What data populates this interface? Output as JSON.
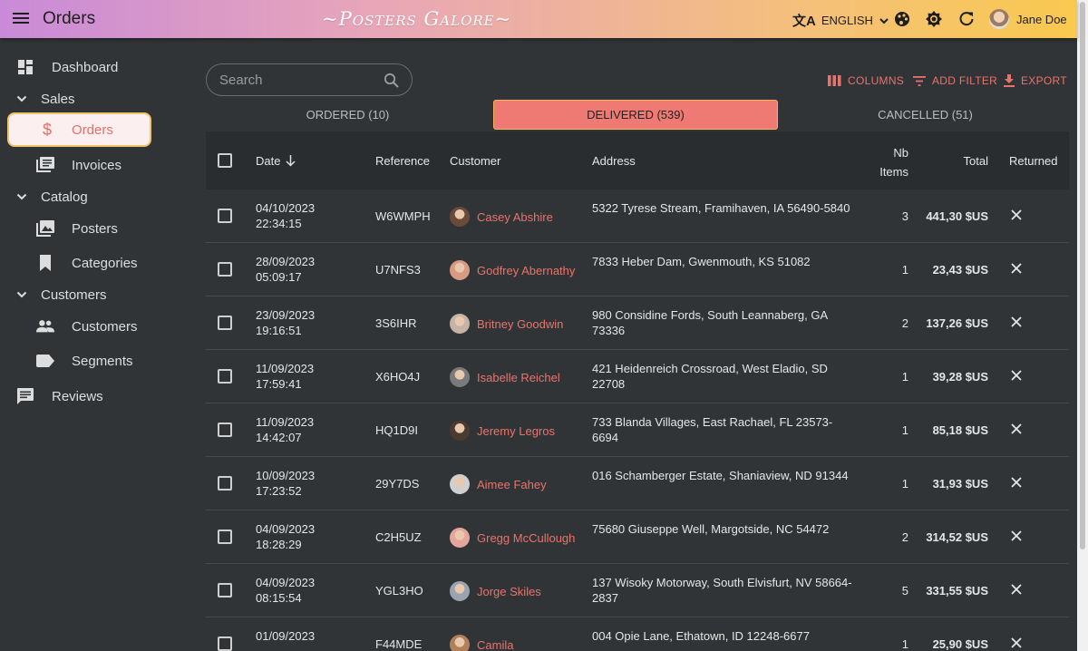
{
  "appbar": {
    "title": "Orders",
    "brand": "~Posters Galore~",
    "language": "ENGLISH",
    "user_name": "Jane Doe"
  },
  "sidebar": {
    "items": [
      {
        "label": "Dashboard",
        "icon": "dashboard-icon"
      },
      {
        "label": "Sales",
        "icon": "chevron-down-icon"
      },
      {
        "label": "Orders",
        "icon": "dollar-icon"
      },
      {
        "label": "Invoices",
        "icon": "invoices-icon"
      },
      {
        "label": "Catalog",
        "icon": "chevron-down-icon"
      },
      {
        "label": "Posters",
        "icon": "image-icon"
      },
      {
        "label": "Categories",
        "icon": "bookmark-icon"
      },
      {
        "label": "Customers",
        "icon": "chevron-down-icon"
      },
      {
        "label": "Customers",
        "icon": "people-icon"
      },
      {
        "label": "Segments",
        "icon": "label-icon"
      },
      {
        "label": "Reviews",
        "icon": "comment-icon"
      }
    ]
  },
  "search": {
    "placeholder": "Search"
  },
  "toolbar": {
    "columns": "COLUMNS",
    "add_filter": "ADD FILTER",
    "export": "EXPORT"
  },
  "tabs": [
    {
      "label": "ORDERED (10)"
    },
    {
      "label": "DELIVERED (539)"
    },
    {
      "label": "CANCELLED (51)"
    }
  ],
  "table": {
    "headers": {
      "date": "Date",
      "reference": "Reference",
      "customer": "Customer",
      "address": "Address",
      "nb_items_1": "Nb",
      "nb_items_2": "Items",
      "total": "Total",
      "returned": "Returned"
    },
    "rows": [
      {
        "date": "04/10/2023",
        "time": "22:34:15",
        "reference": "W6WMPH",
        "customer": "Casey Abshire",
        "address": "5322 Tyrese Stream, Framihaven, IA 56490-5840",
        "items": "3",
        "total": "441,30 $US"
      },
      {
        "date": "28/09/2023",
        "time": "05:09:17",
        "reference": "U7NFS3",
        "customer": "Godfrey Abernathy",
        "address": "7833 Heber Dam, Gwenmouth, KS 51082",
        "items": "1",
        "total": "23,43 $US"
      },
      {
        "date": "23/09/2023",
        "time": "19:16:51",
        "reference": "3S6IHR",
        "customer": "Britney Goodwin",
        "address": "980 Considine Fords, South Leannaberg, GA 73336",
        "items": "2",
        "total": "137,26 $US"
      },
      {
        "date": "11/09/2023",
        "time": "17:59:41",
        "reference": "X6HO4J",
        "customer": "Isabelle Reichel",
        "address": "421 Heidenreich Crossroad, West Eladio, SD 22708",
        "items": "1",
        "total": "39,28 $US"
      },
      {
        "date": "11/09/2023",
        "time": "14:42:07",
        "reference": "HQ1D9I",
        "customer": "Jeremy Legros",
        "address": "733 Blanda Villages, East Rachael, FL 23573-6694",
        "items": "1",
        "total": "85,18 $US"
      },
      {
        "date": "10/09/2023",
        "time": "17:23:52",
        "reference": "29Y7DS",
        "customer": "Aimee Fahey",
        "address": "016 Schamberger Estate, Shaniaview, ND 91344",
        "items": "1",
        "total": "31,93 $US"
      },
      {
        "date": "04/09/2023",
        "time": "18:28:29",
        "reference": "C2H5UZ",
        "customer": "Gregg McCullough",
        "address": "75680 Giuseppe Well, Margotside, NC 54472",
        "items": "2",
        "total": "314,52 $US"
      },
      {
        "date": "04/09/2023",
        "time": "08:15:54",
        "reference": "YGL3HO",
        "customer": "Jorge Skiles",
        "address": "137 Wisoky Motorway, South Elvisfurt, NV 58664-2837",
        "items": "5",
        "total": "331,55 $US"
      },
      {
        "date": "01/09/2023",
        "time": "",
        "reference": "F44MDE",
        "customer": "Camila",
        "address": "004 Opie Lane, Ethatown, ID 12248-6677",
        "items": "1",
        "total": "25,90 $US"
      }
    ]
  },
  "colors": {
    "accent": "#e8736c",
    "appbar_start": "#c98ad8",
    "appbar_end": "#f9c94f",
    "background": "#313436"
  }
}
